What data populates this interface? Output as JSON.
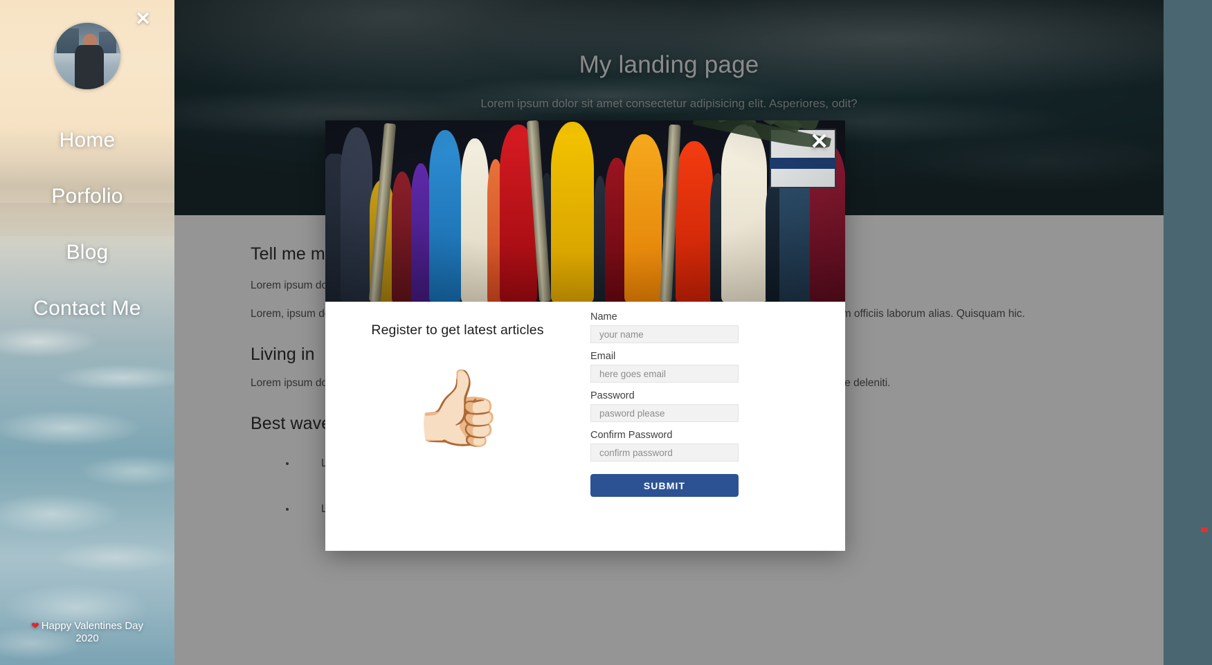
{
  "hero": {
    "title": "My landing page",
    "subtitle": "Lorem ipsum dolor sit amet consectetur adipisicing elit. Asperiores, odit?"
  },
  "sidebar": {
    "close_icon": "✕",
    "avatar_name": "profile-avatar",
    "items": [
      {
        "label": "Home"
      },
      {
        "label": "Porfolio"
      },
      {
        "label": "Blog"
      },
      {
        "label": "Contact Me"
      }
    ],
    "footer": {
      "heart": "❤",
      "line1": "Happy Valentines Day",
      "line2": "2020"
    }
  },
  "article": {
    "section1": {
      "title": "Tell me more",
      "paragraph1": "Lorem ipsum dolor sit amet consectetur adipisicing elit. Quisquam sapiente, sint repellendus.",
      "paragraph2": "Lorem, ipsum dolor sit amet consectetur adipisicing elit. Optio delectus? Harum quidem voluptatibus facere voluptatem veniam officiis laborum alias. Quisquam hic."
    },
    "section2": {
      "title": "Living in",
      "paragraph1": "Lorem ipsum dolor sit amet consectetur adipisicing elit. Perspiciatis laborum excepturi nostrum atque deleniti neque nihil atque deleniti."
    },
    "section3": {
      "title": "Best waves",
      "bullets": [
        "Lorem ipsum dolor sit, amet consectetur adipisicing elit. Est, earum.",
        "Lorem ipsum dolor sit, amet consectetur adipisicing elit. Est, earum."
      ]
    }
  },
  "modal": {
    "close_icon": "✕",
    "heading": "Register to get latest articles",
    "emoji": "👍🏻",
    "fields": [
      {
        "label": "Name",
        "placeholder": "your name",
        "value": "",
        "type": "text"
      },
      {
        "label": "Email",
        "placeholder": "here goes email",
        "value": "",
        "type": "text"
      },
      {
        "label": "Password",
        "placeholder": "pasword please",
        "value": "",
        "type": "text"
      },
      {
        "label": "Confirm Password",
        "placeholder": "confirm password",
        "value": "",
        "type": "text"
      }
    ],
    "submit_label": "SUBMIT"
  },
  "colors": {
    "submit": "#2c5293",
    "overlay": "rgba(20,20,20,.45)",
    "backdrop": "#4a6670",
    "heart": "#e0242b"
  }
}
